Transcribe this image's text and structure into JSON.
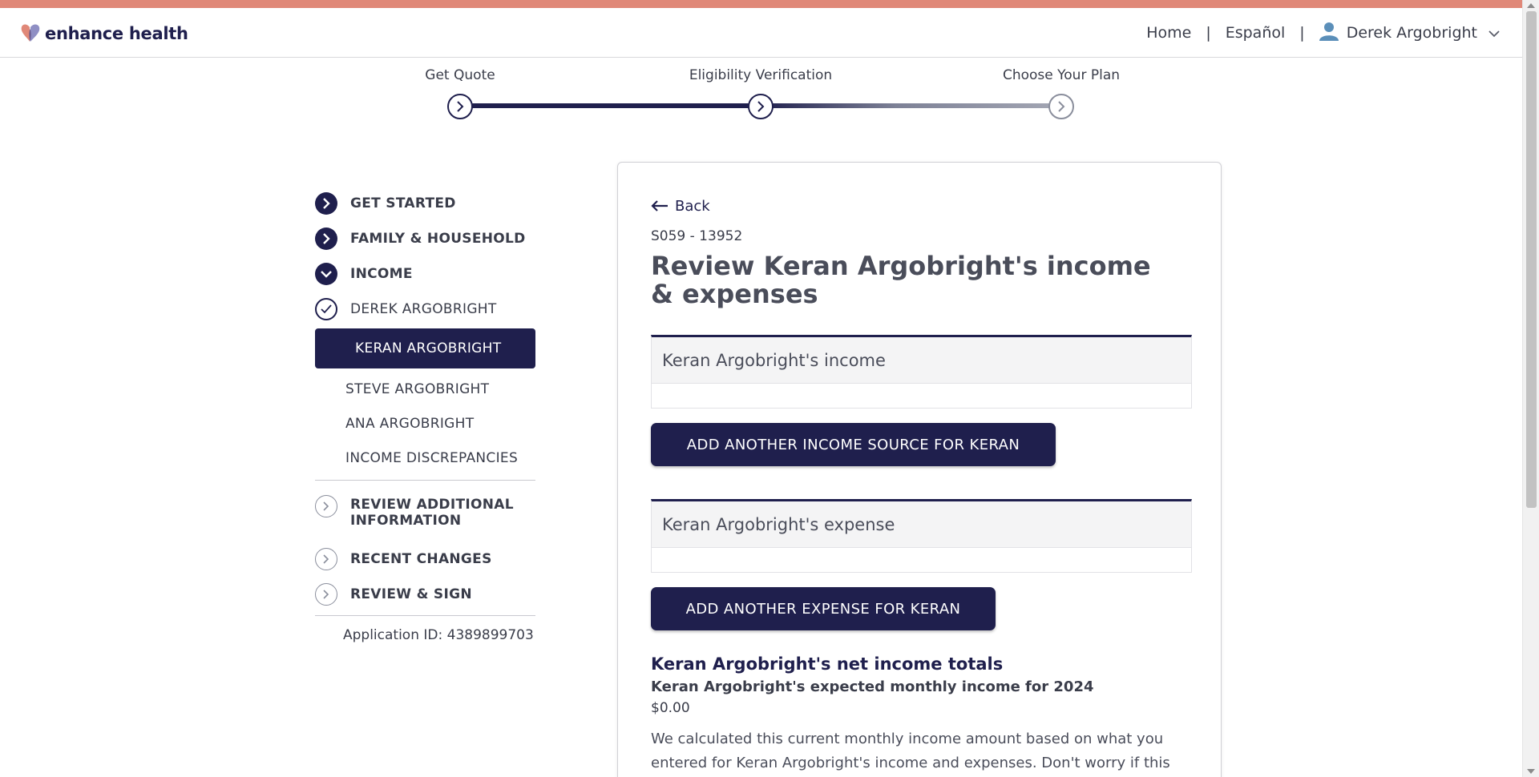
{
  "brand": {
    "name": "enhance health",
    "accent_color": "#e08878",
    "primary_color": "#1f1f4d"
  },
  "nav": {
    "home": "Home",
    "separator": "|",
    "language": "Español",
    "user_name": "Derek Argobright",
    "user_icon": "user-icon",
    "dropdown_icon": "chevron-down-icon"
  },
  "progress": {
    "steps": [
      {
        "label": "Get Quote"
      },
      {
        "label": "Eligibility Verification"
      },
      {
        "label": "Choose Your Plan"
      }
    ]
  },
  "sidebar": {
    "items": [
      {
        "label": "GET STARTED",
        "status": "complete"
      },
      {
        "label": "FAMILY & HOUSEHOLD",
        "status": "complete"
      },
      {
        "label": "INCOME",
        "status": "expanded"
      }
    ],
    "income_members": [
      {
        "label": "DEREK ARGOBRIGHT",
        "status": "checked"
      },
      {
        "label": "KERAN ARGOBRIGHT",
        "status": "active"
      },
      {
        "label": "STEVE ARGOBRIGHT"
      },
      {
        "label": "ANA ARGOBRIGHT"
      },
      {
        "label": "INCOME DISCREPANCIES"
      }
    ],
    "remaining": [
      {
        "label": "REVIEW ADDITIONAL INFORMATION"
      },
      {
        "label": "RECENT CHANGES"
      },
      {
        "label": "REVIEW & SIGN"
      }
    ],
    "application_id": "Application ID: 4389899703"
  },
  "main": {
    "back_label": "Back",
    "case_id": "S059 - 13952",
    "title": "Review Keran Argobright's income & expenses",
    "income_section_title": "Keran Argobright's income",
    "add_income_button": "ADD ANOTHER INCOME SOURCE FOR KERAN",
    "expense_section_title": "Keran Argobright's expense",
    "add_expense_button": "ADD ANOTHER EXPENSE FOR KERAN",
    "totals_title": "Keran Argobright's net income totals",
    "totals_subtitle": "Keran Argobright's expected monthly income for 2024",
    "totals_amount": "$0.00",
    "totals_description": "We calculated this current monthly income amount based on what you entered for Keran Argobright's income and expenses. Don't worry if this"
  }
}
